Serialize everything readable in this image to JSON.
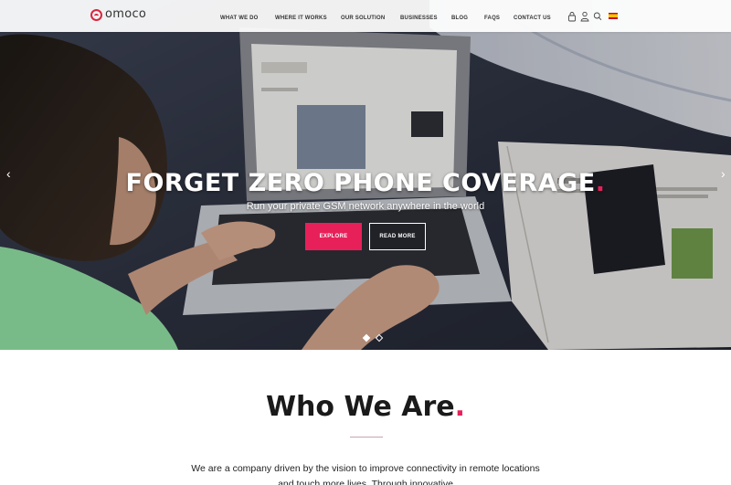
{
  "brand": {
    "name": "omoco",
    "accent_color": "#e8205a",
    "logo_color": "#d9263f"
  },
  "nav": {
    "items": [
      {
        "label": "WHAT WE DO"
      },
      {
        "label": "WHERE IT WORKS"
      },
      {
        "label": "OUR SOLUTION"
      },
      {
        "label": "BUSINESSES"
      },
      {
        "label": "BLOG"
      },
      {
        "label": "FAQs"
      },
      {
        "label": "CONTACT US"
      }
    ],
    "icons": [
      "lock-icon",
      "user-icon",
      "search-icon",
      "spain-flag-icon"
    ]
  },
  "hero": {
    "title": "FORGET ZERO PHONE COVERAGE",
    "title_dot": ".",
    "subtitle": "Run your private GSM network anywhere in the world",
    "explore_label": "EXPLORE",
    "readmore_label": "READ MORE",
    "prev_arrow": "‹",
    "next_arrow": "›",
    "slide_count": 2,
    "active_slide": 1
  },
  "about": {
    "title": "Who We Are",
    "title_dot": ".",
    "text": "We are a company driven by the vision to improve connectivity in remote locations and touch more lives. Through innovative"
  }
}
